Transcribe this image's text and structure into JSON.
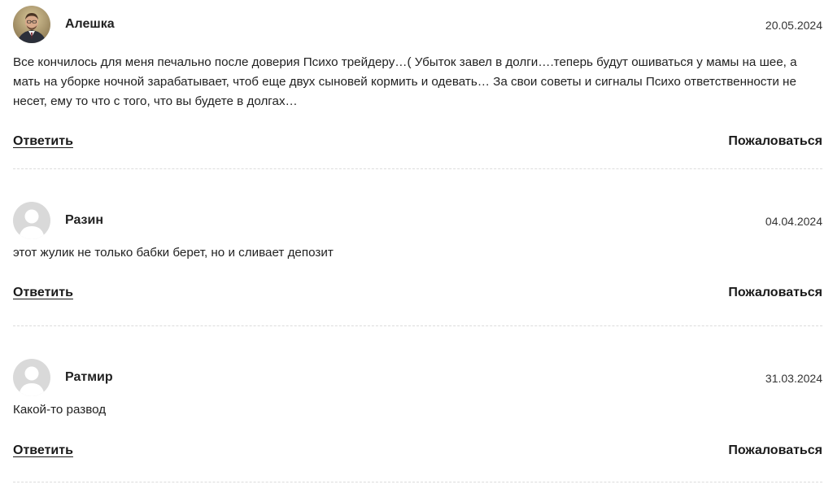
{
  "comments": [
    {
      "author": "Алешка",
      "date": "20.05.2024",
      "avatar": "photo-avatar",
      "text": "Все кончилось для меня печально после доверия Психо трейдеру…( Убыток завел в долги….теперь будут ошиваться у мамы на шее, а мать на уборке ночной зарабатывает, чтоб еще двух сыновей кормить и одевать… За свои советы и сигналы Психо ответственности не несет, ему то что с того, что вы будете в долгах…",
      "reply_label": "Ответить",
      "report_label": "Пожаловаться"
    },
    {
      "author": "Разин",
      "date": "04.04.2024",
      "avatar": "default-avatar",
      "text": "этот жулик не только бабки берет, но и сливает депозит",
      "reply_label": "Ответить",
      "report_label": "Пожаловаться"
    },
    {
      "author": "Ратмир",
      "date": "31.03.2024",
      "avatar": "default-avatar",
      "text": "Какой-то развод",
      "reply_label": "Ответить",
      "report_label": "Пожаловаться"
    }
  ],
  "colors": {
    "text": "#1a1a1a",
    "divider": "#dcdcdc",
    "default_avatar_bg": "#d9d9d9",
    "default_avatar_fg": "#ffffff"
  }
}
